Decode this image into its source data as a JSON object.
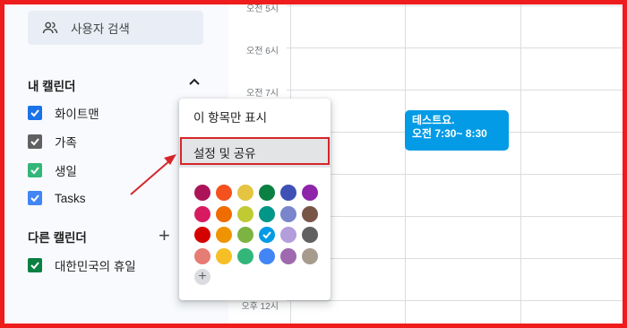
{
  "sidebar": {
    "search_people": "사용자 검색",
    "my_calendars_title": "내 캘린더",
    "my_calendars": [
      {
        "label": "화이트맨",
        "color": "#1a73e8"
      },
      {
        "label": "가족",
        "color": "#616161"
      },
      {
        "label": "생일",
        "color": "#33b679"
      },
      {
        "label": "Tasks",
        "color": "#4285f4"
      }
    ],
    "other_calendars_title": "다른 캘린더",
    "other_calendars": [
      {
        "label": "대한민국의 휴일",
        "color": "#0b8043"
      }
    ]
  },
  "grid": {
    "time_labels": [
      "오전 5시",
      "오전 6시",
      "오전 7시",
      "오후 12시"
    ]
  },
  "event": {
    "title": "테스트요.",
    "time": "오전 7:30~ 8:30",
    "color": "#039be5"
  },
  "context_menu": {
    "items": [
      {
        "label": "이 항목만 표시"
      },
      {
        "label": "설정 및 공유"
      }
    ],
    "colors": [
      [
        "#ad1457",
        "#f4511e",
        "#e4c441",
        "#0b8043",
        "#3f51b5",
        "#8e24aa"
      ],
      [
        "#d81b60",
        "#ef6c00",
        "#c0ca33",
        "#009688",
        "#7986cb",
        "#795548"
      ],
      [
        "#d50000",
        "#f09300",
        "#7cb342",
        "#039be5",
        "#b39ddb",
        "#616161"
      ],
      [
        "#e67c73",
        "#f6bf26",
        "#33b679",
        "#4285f4",
        "#9e69af",
        "#a79b8e"
      ]
    ],
    "selected_color": "#039be5"
  },
  "annotation": {
    "frame_color": "#ee1c1c",
    "arrow_color": "#d6262b"
  }
}
